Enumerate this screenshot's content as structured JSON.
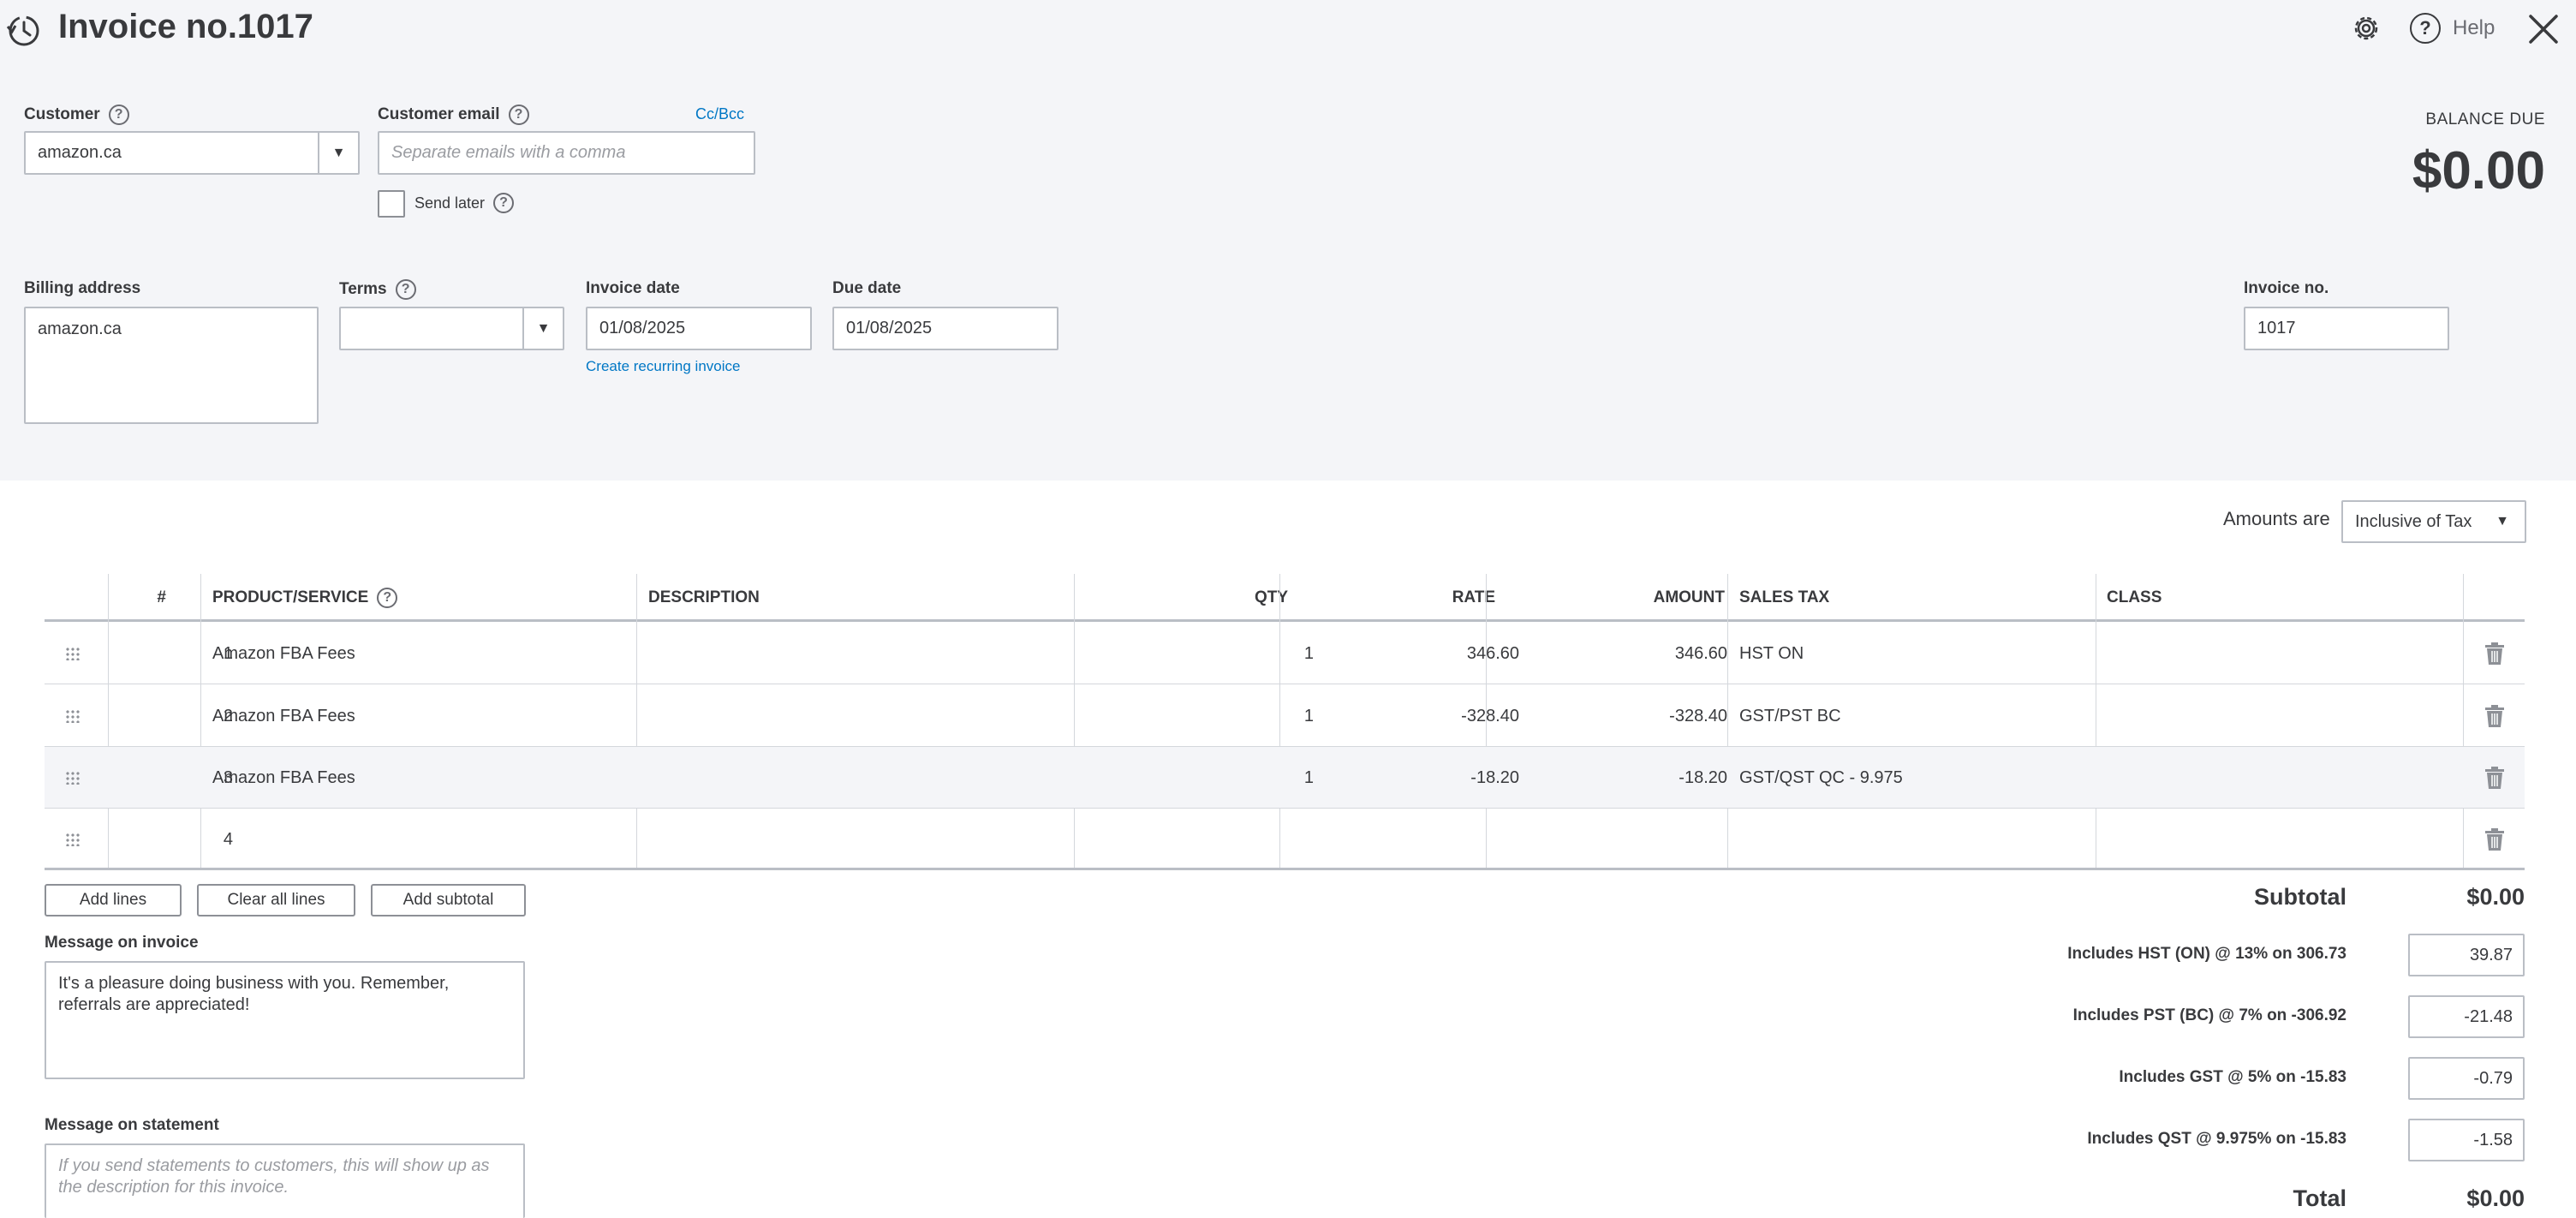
{
  "header": {
    "title": "Invoice no.1017",
    "help_label": "Help"
  },
  "customer": {
    "label": "Customer",
    "value": "amazon.ca"
  },
  "email": {
    "label": "Customer email",
    "placeholder": "Separate emails with a comma",
    "ccbcc": "Cc/Bcc",
    "send_later": "Send later"
  },
  "balance": {
    "label": "BALANCE DUE",
    "amount": "$0.00"
  },
  "billing": {
    "label": "Billing address",
    "value": "amazon.ca"
  },
  "terms": {
    "label": "Terms",
    "value": ""
  },
  "invoice_date": {
    "label": "Invoice date",
    "value": "01/08/2025",
    "recurring_link": "Create recurring invoice"
  },
  "due_date": {
    "label": "Due date",
    "value": "01/08/2025"
  },
  "invoice_no": {
    "label": "Invoice no.",
    "value": "1017"
  },
  "amounts": {
    "label": "Amounts are",
    "value": "Inclusive of Tax"
  },
  "table": {
    "headers": {
      "num": "#",
      "product": "PRODUCT/SERVICE",
      "description": "DESCRIPTION",
      "qty": "QTY",
      "rate": "RATE",
      "amount": "AMOUNT",
      "sales_tax": "SALES TAX",
      "class": "CLASS"
    },
    "rows": [
      {
        "num": "1",
        "product": "Amazon FBA Fees",
        "description": "",
        "qty": "1",
        "rate": "346.60",
        "amount": "346.60",
        "tax": "HST ON",
        "class": ""
      },
      {
        "num": "2",
        "product": "Amazon FBA Fees",
        "description": "",
        "qty": "1",
        "rate": "-328.40",
        "amount": "-328.40",
        "tax": "GST/PST BC",
        "class": ""
      },
      {
        "num": "3",
        "product": "Amazon FBA Fees",
        "description": "",
        "qty": "1",
        "rate": "-18.20",
        "amount": "-18.20",
        "tax": "GST/QST QC - 9.975",
        "class": ""
      },
      {
        "num": "4",
        "product": "",
        "description": "",
        "qty": "",
        "rate": "",
        "amount": "",
        "tax": "",
        "class": ""
      }
    ]
  },
  "buttons": {
    "add_lines": "Add lines",
    "clear_lines": "Clear all lines",
    "add_subtotal": "Add subtotal"
  },
  "message_invoice": {
    "label": "Message on invoice",
    "value": "It's a pleasure doing business with you.  Remember, referrals are appreciated!"
  },
  "message_statement": {
    "label": "Message on statement",
    "placeholder": "If you send statements to customers, this will show up as the description for this invoice."
  },
  "totals": {
    "subtotal_label": "Subtotal",
    "subtotal_value": "$0.00",
    "taxes": [
      {
        "label": "Includes HST (ON) @ 13% on 306.73",
        "value": "39.87"
      },
      {
        "label": "Includes PST (BC) @ 7% on -306.92",
        "value": "-21.48"
      },
      {
        "label": "Includes GST @ 5% on -15.83",
        "value": "-0.79"
      },
      {
        "label": "Includes QST @ 9.975% on -15.83",
        "value": "-1.58"
      }
    ],
    "total_label": "Total",
    "total_value": "$0.00"
  }
}
